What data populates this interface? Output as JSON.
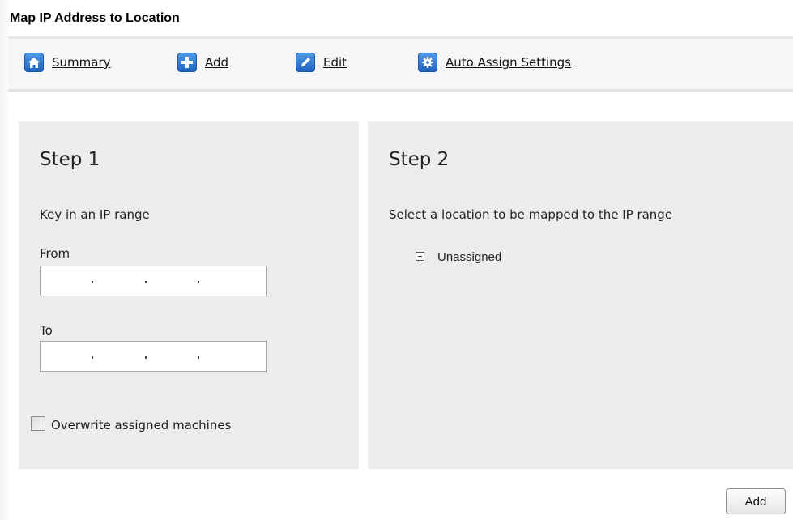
{
  "window": {
    "title": "Map IP Address to Location"
  },
  "toolbar": {
    "items": [
      {
        "label": "Summary",
        "icon": "home-icon"
      },
      {
        "label": "Add",
        "icon": "plus-icon"
      },
      {
        "label": "Edit",
        "icon": "pencil-icon"
      },
      {
        "label": "Auto Assign Settings",
        "icon": "gear-icon"
      }
    ]
  },
  "step1": {
    "title": "Step 1",
    "instruction": "Key in an IP range",
    "from_label": "From",
    "from_value": "",
    "to_label": "To",
    "to_value": "",
    "overwrite_label": "Overwrite assigned machines",
    "overwrite_checked": false
  },
  "step2": {
    "title": "Step 2",
    "instruction": "Select a location to be mapped to the IP range",
    "tree": [
      {
        "label": "Unassigned",
        "expanded": true
      }
    ]
  },
  "footer": {
    "add_label": "Add"
  },
  "colors": {
    "accent": "#2a6fcf",
    "panel": "#ececec",
    "toolbar": "#f6f6f6"
  }
}
